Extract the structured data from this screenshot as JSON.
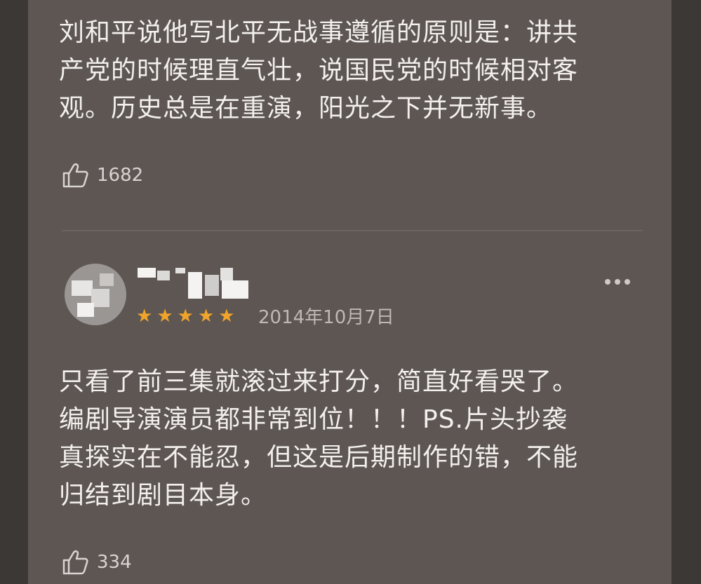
{
  "comments": [
    {
      "text": "刘和平说他写北平无战事遵循的原则是：讲共\n产党的时候理直气壮，说国民党的时候相对客\n观。历史总是在重演，阳光之下并无新事。",
      "likes": "1682"
    },
    {
      "rating": 5,
      "date": "2014年10月7日",
      "text": "只看了前三集就滚过来打分，简直好看哭了。\n编剧导演演员都非常到位！！！PS.片头抄袭\n真探实在不能忍，但这是后期制作的错，不能\n归结到剧目本身。",
      "likes": "334"
    }
  ],
  "icons": {
    "like": "thumbs-up-icon",
    "more": "more-dots-icon",
    "star": "star-icon"
  },
  "colors": {
    "star": "#f0a52a",
    "panel": "#5d5653",
    "text": "#f2efed"
  }
}
